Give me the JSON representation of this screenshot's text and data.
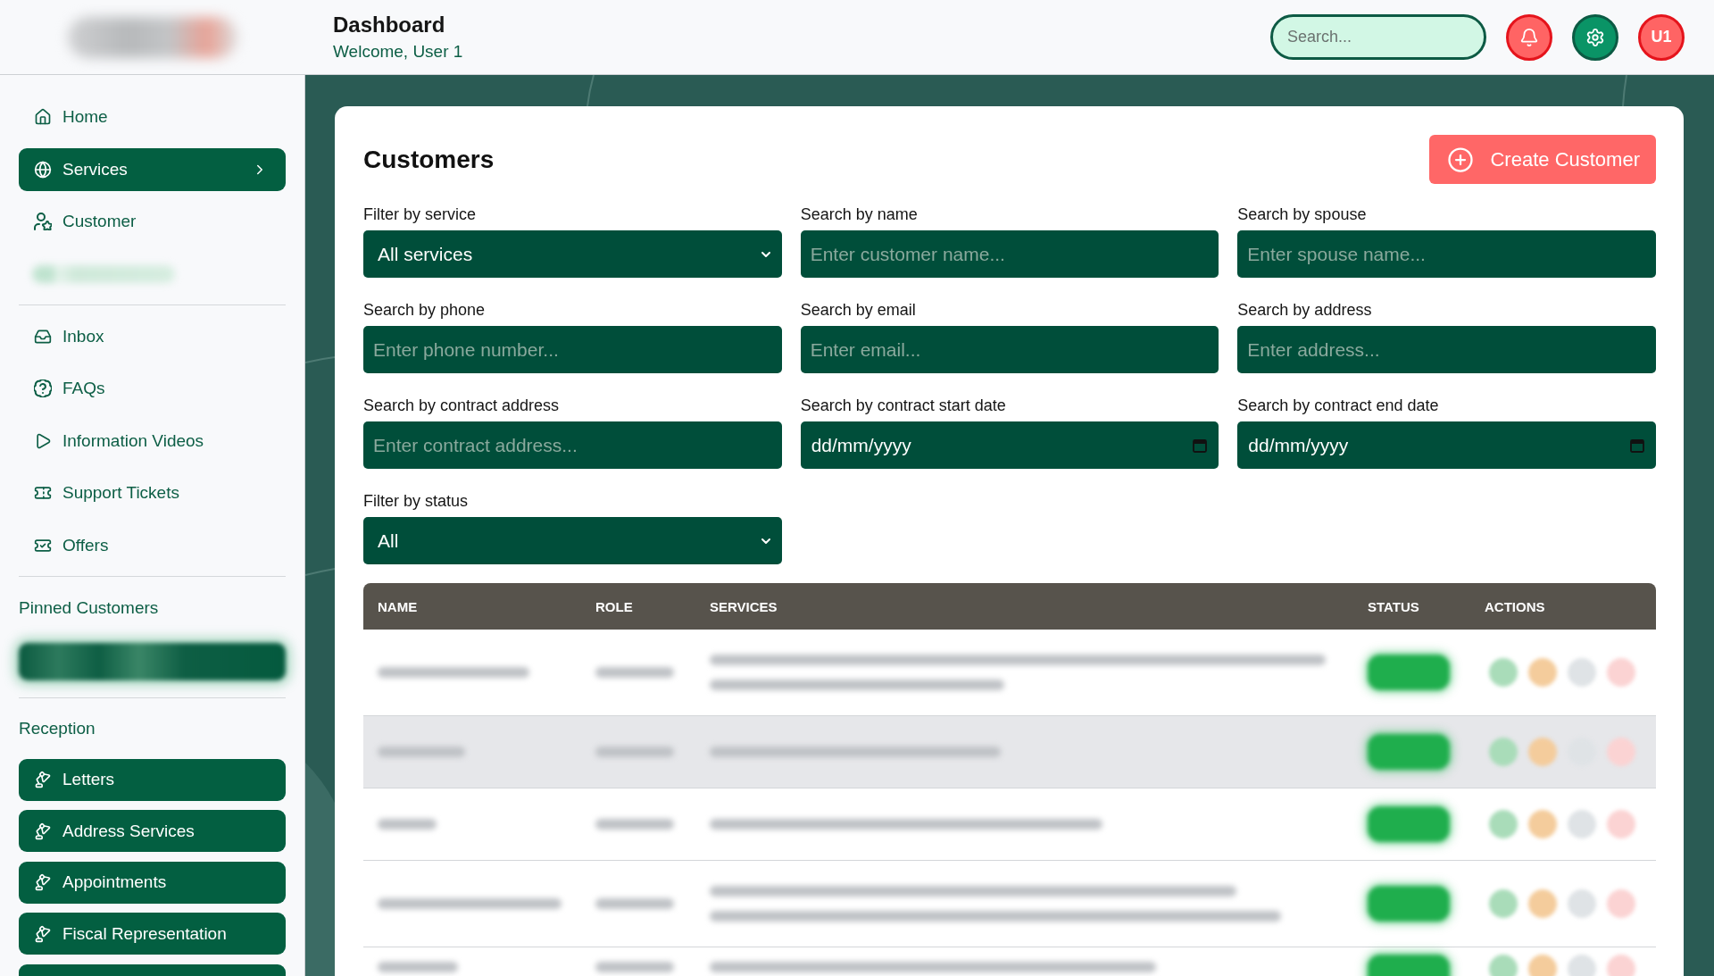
{
  "header": {
    "title": "Dashboard",
    "subtitle": "Welcome, User 1",
    "search": {
      "placeholder": "Search..."
    },
    "avatar": {
      "initials": "U1"
    }
  },
  "sidebar": {
    "groups": [
      {
        "items": [
          {
            "kind": "link",
            "label": "Home",
            "selected": false,
            "has_submenu": false
          },
          {
            "kind": "link",
            "label": "Services",
            "selected": true,
            "has_submenu": true
          },
          {
            "kind": "link",
            "label": "Customer",
            "selected": false,
            "has_submenu": false
          },
          {
            "kind": "redacted"
          }
        ]
      },
      {
        "items": [
          {
            "kind": "link",
            "label": "Inbox",
            "selected": false,
            "has_submenu": false
          },
          {
            "kind": "link",
            "label": "FAQs",
            "selected": false,
            "has_submenu": false
          },
          {
            "kind": "link",
            "label": "Information Videos",
            "selected": false,
            "has_submenu": false
          },
          {
            "kind": "link",
            "label": "Support Tickets",
            "selected": false,
            "has_submenu": false
          },
          {
            "kind": "link",
            "label": "Offers",
            "selected": false,
            "has_submenu": false
          }
        ]
      },
      {
        "title": "Pinned Customers",
        "items": [
          {
            "kind": "pinned"
          }
        ]
      },
      {
        "title": "Reception",
        "items": [
          {
            "kind": "button",
            "label": "Letters"
          },
          {
            "kind": "button",
            "label": "Address Services"
          },
          {
            "kind": "button",
            "label": "Appointments"
          },
          {
            "kind": "button",
            "label": "Fiscal Representation"
          },
          {
            "kind": "button"
          }
        ]
      }
    ]
  },
  "page": {
    "title": "Customers",
    "create_button": {
      "label": "Create Customer"
    },
    "filters": [
      {
        "kind": "select",
        "label": "Filter by service",
        "value": "All services"
      },
      {
        "kind": "text",
        "label": "Search by name",
        "placeholder": "Enter customer name..."
      },
      {
        "kind": "text",
        "label": "Search by spouse",
        "placeholder": "Enter spouse name..."
      },
      {
        "kind": "text",
        "label": "Search by phone",
        "placeholder": "Enter phone number..."
      },
      {
        "kind": "text",
        "label": "Search by email",
        "placeholder": "Enter email..."
      },
      {
        "kind": "text",
        "label": "Search by address",
        "placeholder": "Enter address..."
      },
      {
        "kind": "text",
        "label": "Search by contract address",
        "placeholder": "Enter contract address..."
      },
      {
        "kind": "date",
        "label": "Search by contract start date",
        "placeholder": "dd/mm/yyyy"
      },
      {
        "kind": "date",
        "label": "Search by contract end date",
        "placeholder": "dd/mm/yyyy"
      },
      {
        "kind": "select",
        "label": "Filter by status",
        "value": "All"
      }
    ],
    "table": {
      "columns": [
        "NAME",
        "ROLE",
        "SERVICES",
        "STATUS",
        "ACTIONS"
      ],
      "rows": [
        {
          "highlighted": false
        },
        {
          "highlighted": true
        },
        {
          "highlighted": false
        },
        {
          "highlighted": false
        },
        {
          "highlighted": false
        }
      ]
    }
  }
}
